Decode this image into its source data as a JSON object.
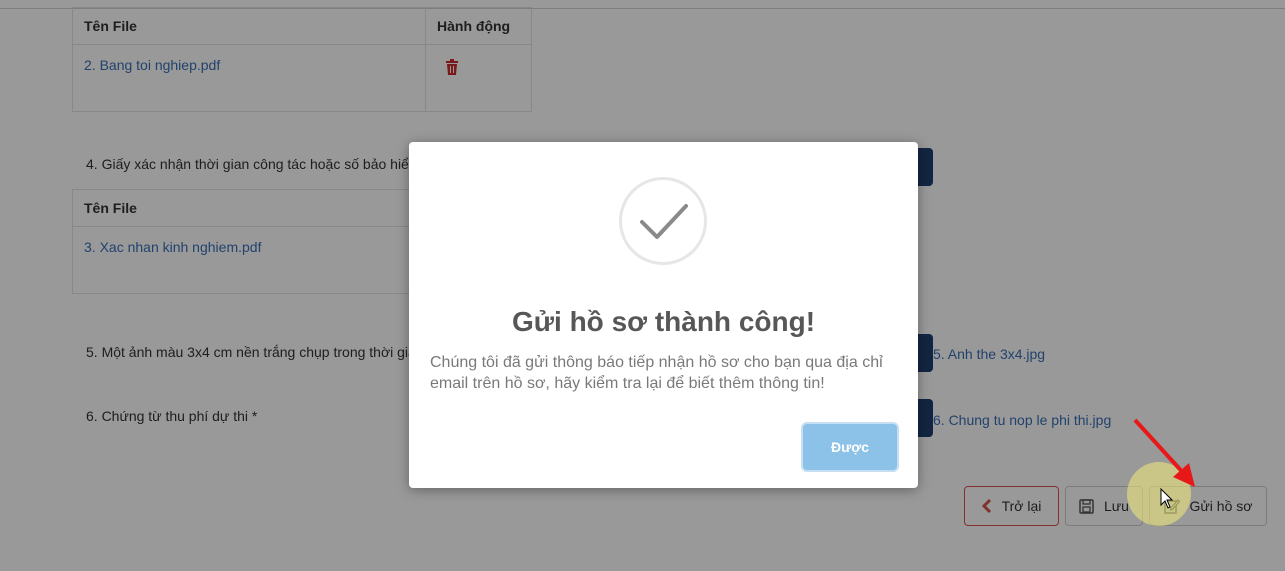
{
  "uploaded_table_1": {
    "headers": [
      "Tên File",
      "Hành động"
    ],
    "rows": [
      {
        "file": "2. Bang toi nghiep.pdf"
      }
    ]
  },
  "requirements": [
    {
      "label": "4. Giấy xác nhận thời gian công tác hoặc số bảo hiể"
    },
    {
      "label": "5. Một ảnh màu 3x4 cm nền trắng chụp trong thời gia",
      "uploaded_file": "5. Anh the 3x4.jpg"
    },
    {
      "label": "6. Chứng từ thu phí dự thi *",
      "uploaded_file": "6. Chung tu nop le phi thi.jpg"
    }
  ],
  "uploaded_table_2": {
    "headers": [
      "Tên File"
    ],
    "rows": [
      {
        "file": "3. Xac nhan kinh nghiem.pdf"
      }
    ]
  },
  "actions": {
    "back_label": "Trở lại",
    "save_label": "Lưu",
    "send_label": "Gửi hồ sơ"
  },
  "dialog": {
    "title": "Gửi hồ sơ thành công!",
    "message": "Chúng tôi đã gửi thông báo tiếp nhận hồ sơ cho bạn qua địa chỉ email trên hồ sơ, hãy kiểm tra lại để biết thêm thông tin!",
    "confirm_label": "Được",
    "icon": "check-icon"
  },
  "colors": {
    "link": "#3a6fb5",
    "upload_button": "#1f3f6e",
    "confirm_button": "#8cc1e8",
    "danger": "#d9534f"
  }
}
